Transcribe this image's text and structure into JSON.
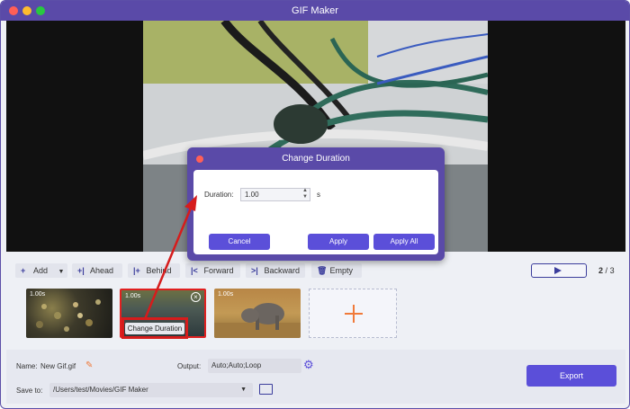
{
  "window": {
    "title": "GIF Maker"
  },
  "toolbar": {
    "add_label": "Add",
    "ahead_label": "Ahead",
    "behind_label": "Behind",
    "forward_label": "Forward",
    "backward_label": "Backward",
    "empty_label": "Empty",
    "page_current": "2",
    "page_sep": "/",
    "page_total": "3"
  },
  "thumbnails": [
    {
      "duration": "1.00s"
    },
    {
      "duration": "1.00s"
    },
    {
      "duration": "1.00s"
    }
  ],
  "change_duration_button": "Change Duration",
  "dialog": {
    "title": "Change Duration",
    "duration_label": "Duration:",
    "duration_value": "1.00",
    "unit": "s",
    "cancel_label": "Cancel",
    "apply_label": "Apply",
    "apply_all_label": "Apply All"
  },
  "bottom": {
    "name_label": "Name:",
    "name_value": "New Gif.gif",
    "output_label": "Output:",
    "output_value": "Auto;Auto;Loop",
    "save_label": "Save to:",
    "save_path": "/Users/test/Movies/GIF Maker",
    "export_label": "Export"
  },
  "colors": {
    "accent": "#5b4fd9",
    "titlebar": "#5a4aa8",
    "highlight_red": "#d61c1c"
  }
}
